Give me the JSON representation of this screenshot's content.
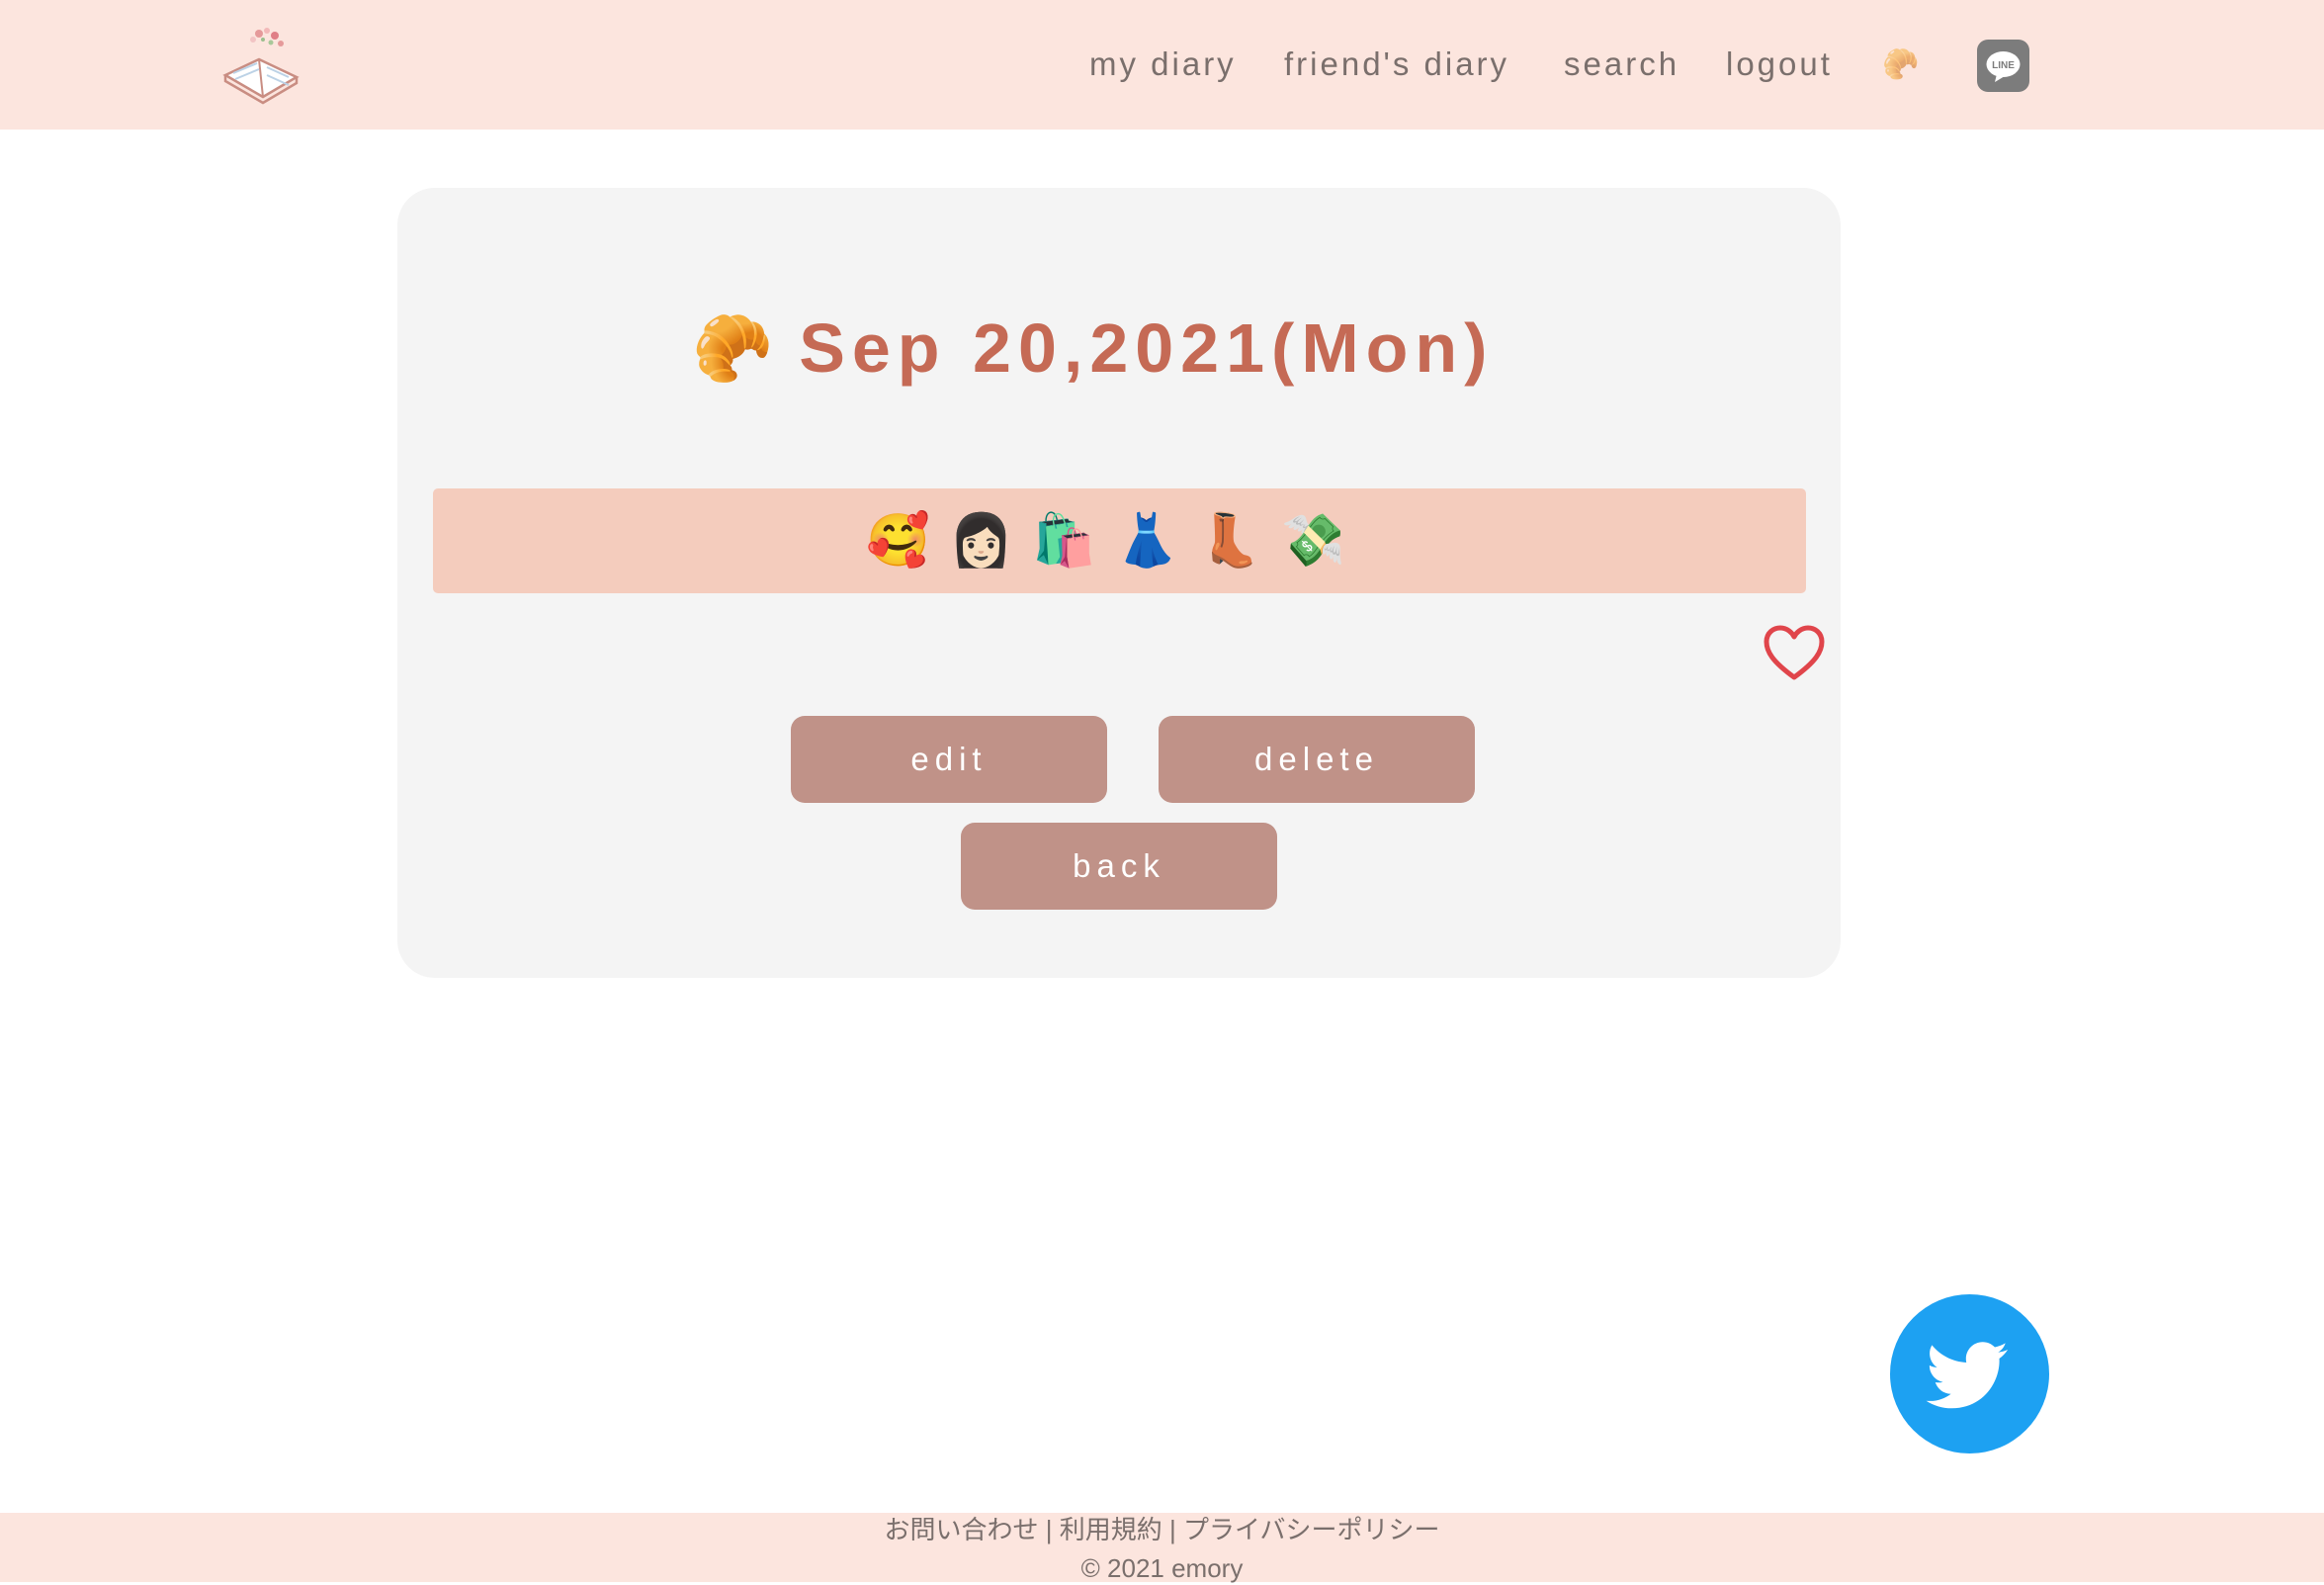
{
  "header": {
    "nav": {
      "my_diary": "my diary",
      "friends_diary": "friend's diary",
      "search": "search",
      "logout": "logout",
      "emoji_link": "🥐",
      "line_label": "LINE"
    },
    "background": "#fce5de"
  },
  "entry": {
    "date_emoji": "🥐",
    "date": "Sep 20,2021(Mon)",
    "emojis": [
      "🥰",
      "👩🏻",
      "🛍️",
      "👗",
      "👢",
      "💸"
    ],
    "liked": false
  },
  "actions": {
    "edit": "edit",
    "delete": "delete",
    "back": "back"
  },
  "footer": {
    "contact": "お問い合わせ",
    "separator": " | ",
    "terms": "利用規約",
    "privacy": "プライバシーポリシー",
    "copyright": "© 2021 emory"
  },
  "colors": {
    "accent": "#c56a55",
    "button": "#c09288",
    "twitter": "#1da1f2",
    "heart": "#e0454b"
  }
}
